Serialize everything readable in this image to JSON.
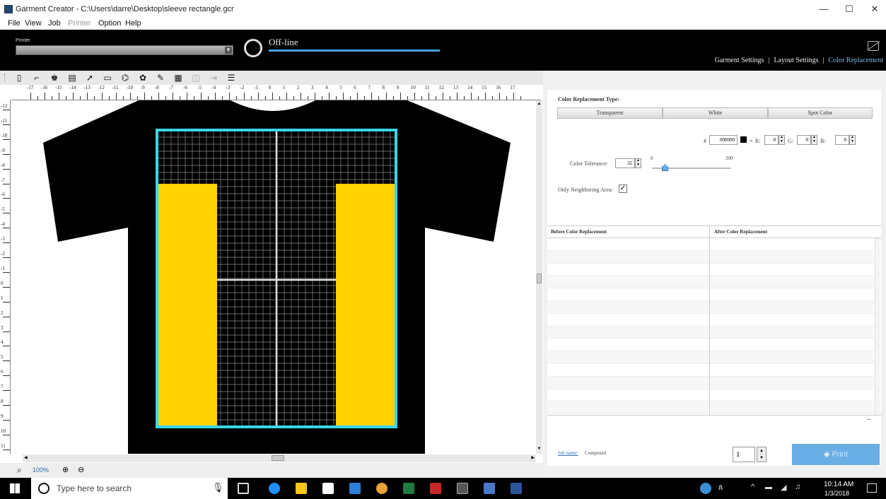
{
  "window": {
    "title": "Garment Creator - C:\\Users\\darre\\Desktop\\sleeve rectangle.gcr",
    "minimize": "—",
    "maximize": "☐",
    "close": "✕"
  },
  "menu": [
    {
      "label": "File",
      "disabled": false
    },
    {
      "label": "View",
      "disabled": false
    },
    {
      "label": "Job",
      "disabled": false
    },
    {
      "label": "Printer",
      "disabled": true
    },
    {
      "label": "Option",
      "disabled": false
    },
    {
      "label": "Help",
      "disabled": false
    }
  ],
  "printer_bar": {
    "label": "Printer",
    "selected": "",
    "status": "Off-line",
    "progress": 1.0
  },
  "settings_nav": {
    "garment": "Garment Settings",
    "layout": "Layout Settings",
    "color": "Color Replacement",
    "separator": "|",
    "active": "color"
  },
  "toolbar_icons": [
    "new-icon",
    "open-icon",
    "tshirt-icon",
    "save-icon",
    "export-icon",
    "rectangle-icon",
    "shape-icon",
    "color-icon",
    "eyedropper-icon",
    "calculator-icon",
    "align-center-icon",
    "align-right-icon",
    "list-icon"
  ],
  "ruler": {
    "top_labels": [
      "-17",
      "-16",
      "-15",
      "-14",
      "-13",
      "-12",
      "-11",
      "-10",
      "-9",
      "-8",
      "-7",
      "-6",
      "-5",
      "-4",
      "-3",
      "-2",
      "-1",
      "0",
      "1",
      "2",
      "3",
      "4",
      "5",
      "6",
      "7",
      "8",
      "9",
      "10",
      "11",
      "12",
      "13",
      "14",
      "15",
      "16",
      "17"
    ],
    "left_labels": [
      "-12",
      "-11",
      "-10",
      "-9",
      "-8",
      "-7",
      "-6",
      "-5",
      "-4",
      "-3",
      "-2",
      "-1",
      "0",
      "1",
      "2",
      "3",
      "4",
      "5",
      "6",
      "7",
      "8",
      "9",
      "10",
      "11"
    ]
  },
  "zoom": {
    "value": "100%"
  },
  "color_replacement": {
    "types_label": "Color Replacement Type:",
    "types": [
      "Transparent",
      "White",
      "Spot Color"
    ],
    "hex": "000000",
    "rgb": {
      "r_label": "R:",
      "g_label": "G:",
      "b_label": "B:",
      "r": "0",
      "g": "0",
      "b": "0"
    },
    "tolerance_label": "Color Tolerance:",
    "tolerance": "32",
    "slider_min": "0",
    "slider_max": "200",
    "neighboring_label": "Only Neighboring Area:",
    "neighboring_checked": true,
    "table_headers": [
      "Before Color Replacement",
      "After Color Replacement"
    ],
    "job_name_label": "Job name:",
    "job_name_value": "Composed",
    "copies": "1",
    "print_label": "Print"
  },
  "taskbar": {
    "search_placeholder": "Type here to search",
    "time": "10:14 AM",
    "date": "1/3/2018"
  },
  "colors": {
    "shirt": "#000000",
    "yellow": "#ffd200",
    "border_cyan": "#3ad6e8",
    "accent_blue": "#7ab8e8"
  }
}
